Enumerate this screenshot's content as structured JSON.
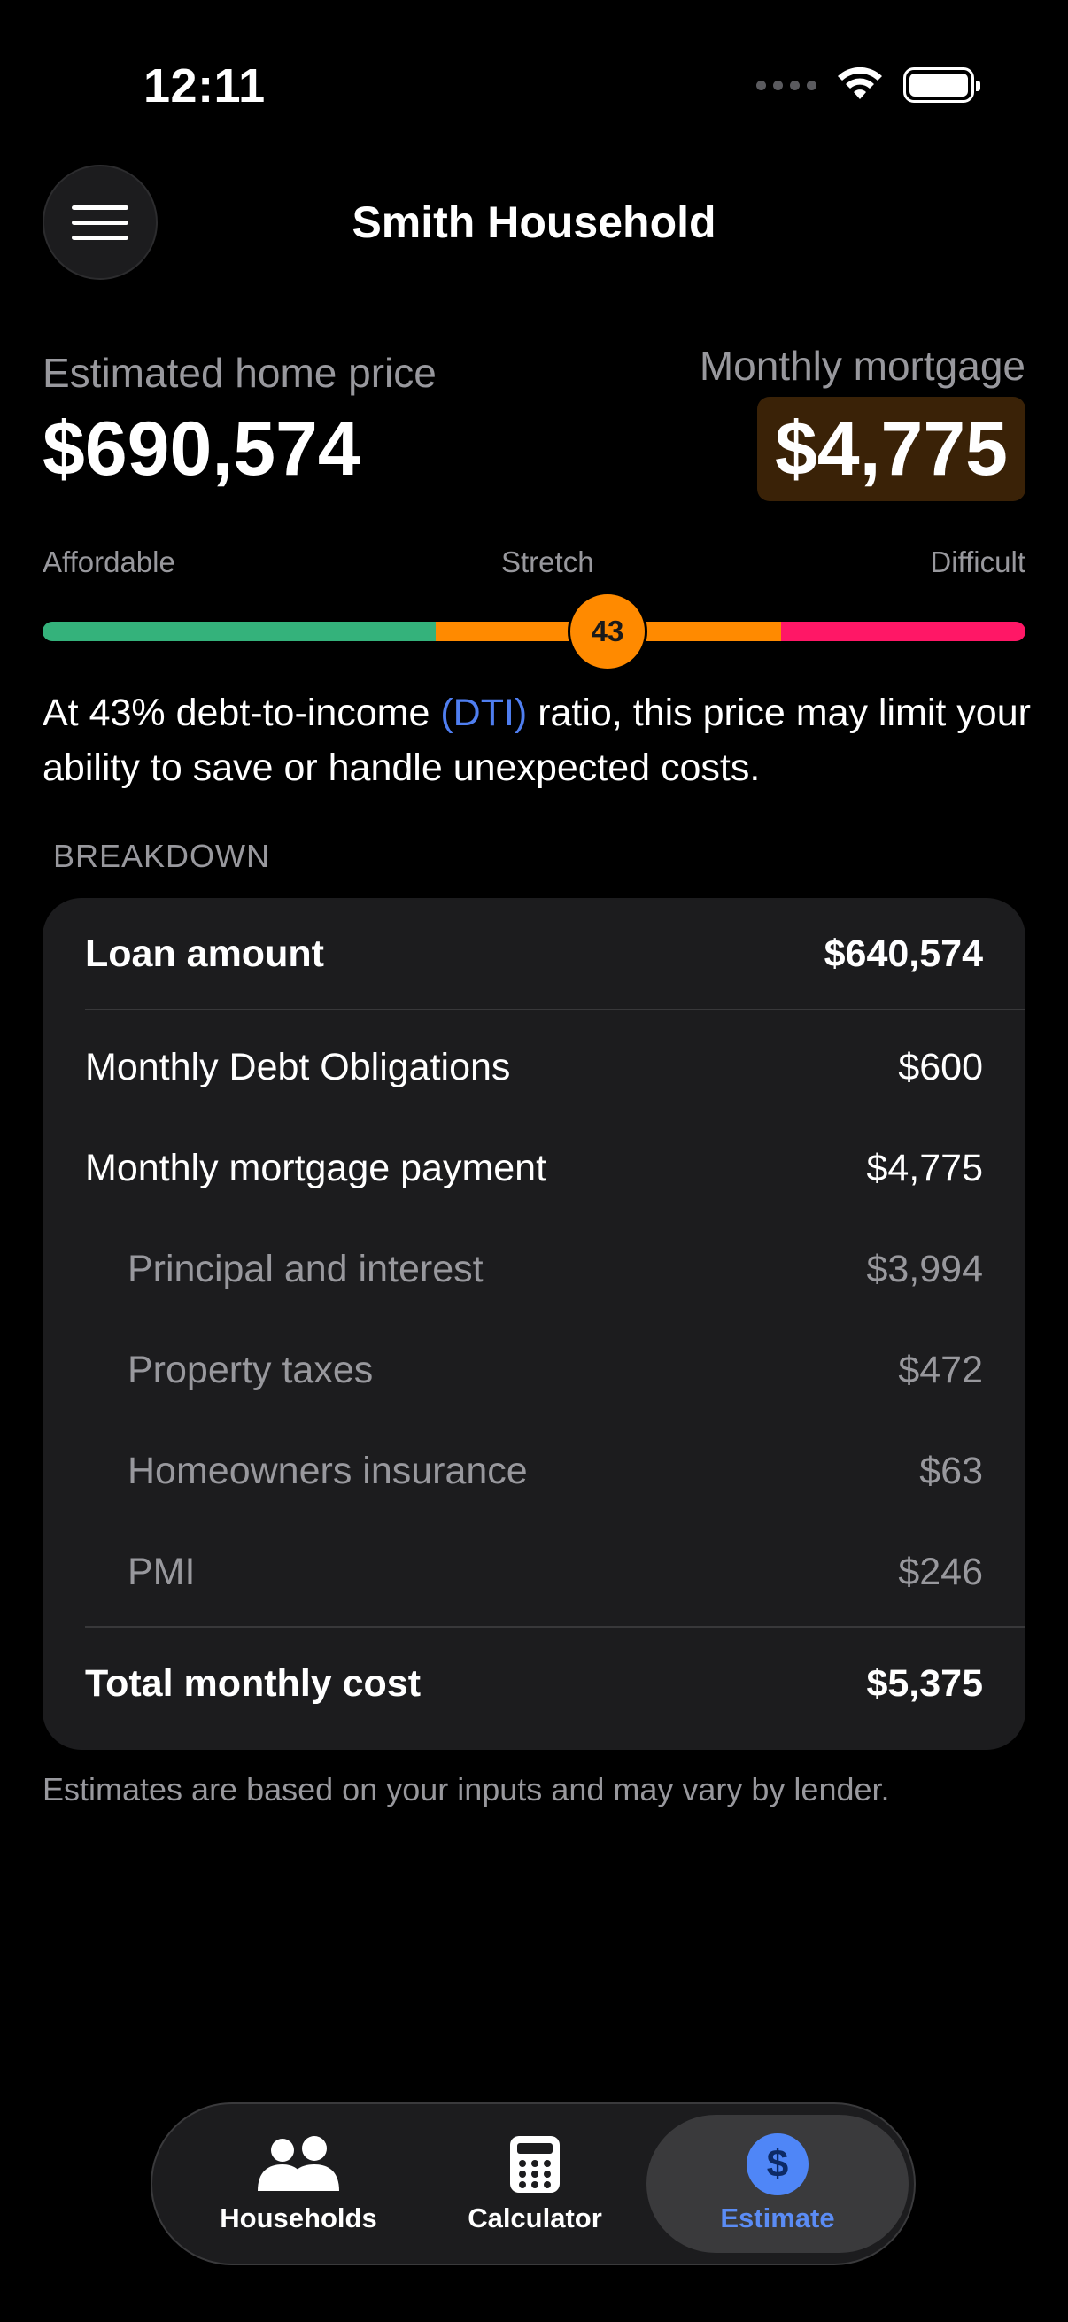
{
  "status_bar": {
    "time": "12:11"
  },
  "header": {
    "title": "Smith Household"
  },
  "summary": {
    "price_label": "Estimated home price",
    "price_value": "$690,574",
    "mortgage_label": "Monthly mortgage",
    "mortgage_value": "$4,775",
    "mortgage_badge_color": "#3a2207"
  },
  "gauge": {
    "labels": {
      "left": "Affordable",
      "middle": "Stretch",
      "right": "Difficult"
    },
    "value": 43,
    "value_label": "43",
    "colors": {
      "affordable": "#34b27b",
      "stretch": "#ff8a00",
      "difficult": "#ff1766"
    }
  },
  "dti_message": {
    "before": "At 43% debt-to-income ",
    "link": "(DTI)",
    "after": " ratio, this price may limit your ability to save or handle unexpected costs."
  },
  "breakdown": {
    "header": "BREAKDOWN",
    "loan": {
      "label": "Loan amount",
      "value": "$640,574"
    },
    "debt": {
      "label": "Monthly Debt Obligations",
      "value": "$600"
    },
    "mortgage": {
      "label": "Monthly mortgage payment",
      "value": "$4,775"
    },
    "items": [
      {
        "label": "Principal and interest",
        "value": "$3,994"
      },
      {
        "label": "Property taxes",
        "value": "$472"
      },
      {
        "label": "Homeowners insurance",
        "value": "$63"
      },
      {
        "label": "PMI",
        "value": "$246"
      }
    ],
    "total": {
      "label": "Total monthly cost",
      "value": "$5,375"
    }
  },
  "footnote": "Estimates are based on your inputs and may vary by lender.",
  "tabs": [
    {
      "label": "Households",
      "icon": "people-icon"
    },
    {
      "label": "Calculator",
      "icon": "calculator-icon"
    },
    {
      "label": "Estimate",
      "icon": "dollar-icon",
      "active": true
    }
  ],
  "accent_color": "#4f86f7"
}
